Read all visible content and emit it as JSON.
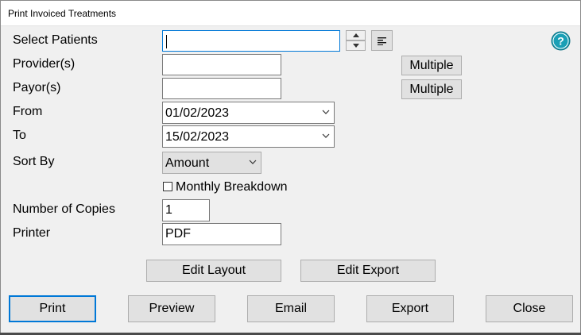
{
  "window": {
    "title": "Print Invoiced Treatments"
  },
  "labels": {
    "select_patients": "Select Patients",
    "providers": "Provider(s)",
    "payors": "Payor(s)",
    "from": "From",
    "to": "To",
    "sort_by": "Sort By",
    "number_of_copies": "Number of Copies",
    "printer": "Printer"
  },
  "fields": {
    "select_patients": "",
    "providers": "",
    "payors": "",
    "from_date": "01/02/2023",
    "to_date": "15/02/2023",
    "sort_by": "Amount",
    "copies": "1",
    "printer": "PDF"
  },
  "checkbox": {
    "monthly_breakdown_label": "Monthly Breakdown",
    "monthly_breakdown_checked": false
  },
  "buttons": {
    "provider_multiple": "Multiple",
    "payor_multiple": "Multiple",
    "edit_layout": "Edit Layout",
    "edit_export": "Edit Export",
    "print": "Print",
    "preview": "Preview",
    "email": "Email",
    "export": "Export",
    "close": "Close"
  },
  "icons": {
    "help": "help-icon",
    "spin_up": "spin-up-icon",
    "spin_down": "spin-down-icon",
    "list": "list-icon",
    "dropdown": "chevron-down-icon"
  },
  "colors": {
    "accent": "#0078d7",
    "help_icon": "#1a9fb5",
    "dialog_bg": "#f0f0f0",
    "button_bg": "#e1e1e1"
  }
}
